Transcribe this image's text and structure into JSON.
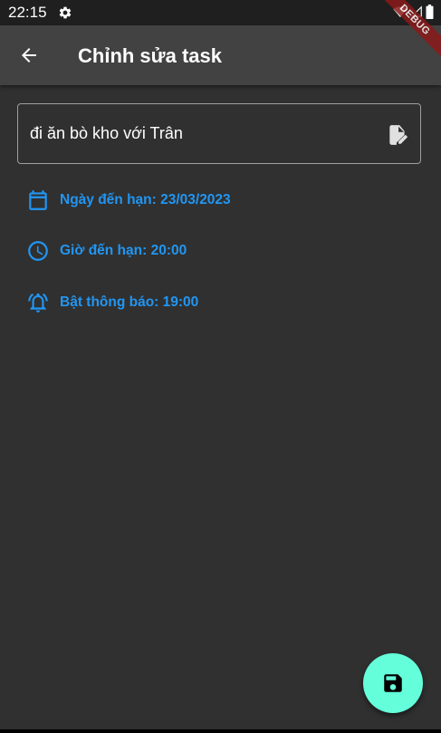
{
  "status_bar": {
    "time": "22:15",
    "icons": [
      "settings-gear-icon",
      "wifi-icon",
      "cell-signal-icon",
      "battery-icon"
    ],
    "debug_banner": "DEBUG"
  },
  "app_bar": {
    "back_icon": "arrow-left-icon",
    "title": "Chỉnh sửa task"
  },
  "task_field": {
    "value": "đi ăn bò kho với Trân",
    "trailing_icon": "edit-note-icon"
  },
  "details": {
    "due_date": {
      "icon": "calendar-icon",
      "label": "Ngày đến hạn: 23/03/2023"
    },
    "due_time": {
      "icon": "clock-icon",
      "label": "Giờ đến hạn: 20:00"
    },
    "notification": {
      "icon": "alarm-bell-icon",
      "label": "Bật thông báo: 19:00"
    }
  },
  "fab": {
    "icon": "save-icon"
  },
  "colors": {
    "background": "#303030",
    "app_bar": "#424242",
    "status_bar": "#1f1f1f",
    "accent_blue": "#2196f3",
    "fab": "#64ffda",
    "outline": "#9e9e9e"
  }
}
